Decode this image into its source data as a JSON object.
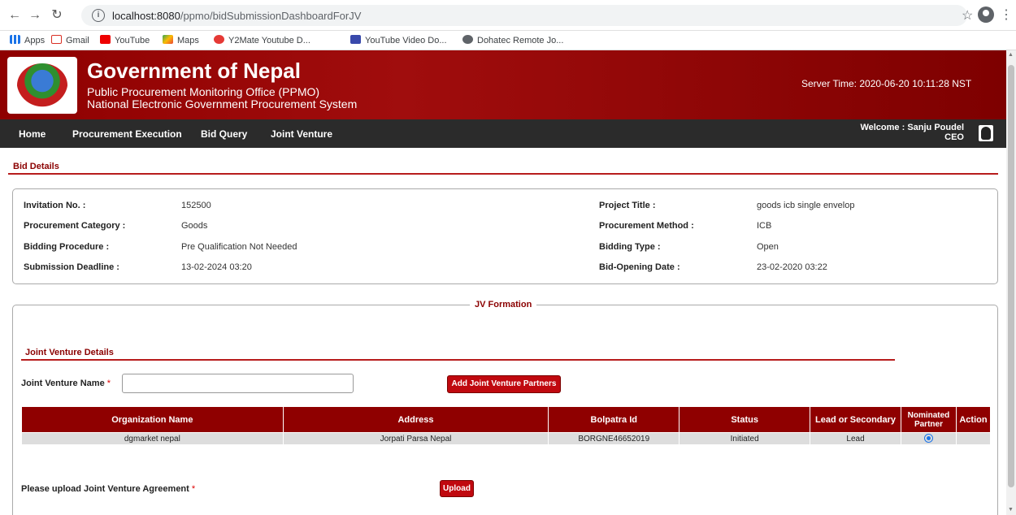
{
  "browser": {
    "url_host": "localhost:8080",
    "url_path": "/ppmo/bidSubmissionDashboardForJV",
    "bookmarks": [
      "Apps",
      "Gmail",
      "YouTube",
      "Maps",
      "Y2Mate Youtube D...",
      "YouTube Video Do...",
      "Dohatec Remote Jo..."
    ]
  },
  "header": {
    "title": "Government of Nepal",
    "subtitle1": "Public Procurement Monitoring Office (PPMO)",
    "subtitle2": "National Electronic Government Procurement System",
    "server_time": "Server Time: 2020-06-20 10:11:28 NST"
  },
  "nav": {
    "items": [
      "Home",
      "Procurement Execution",
      "Bid Query",
      "Joint Venture"
    ],
    "welcome": "Welcome : Sanju Poudel",
    "role": "CEO"
  },
  "bid_details": {
    "section_title": "Bid Details",
    "rows": [
      {
        "label": "Invitation No. :",
        "value": "152500",
        "label2": "Project Title :",
        "value2": "goods icb single envelop"
      },
      {
        "label": "Procurement Category :",
        "value": "Goods",
        "label2": "Procurement Method :",
        "value2": "ICB"
      },
      {
        "label": "Bidding Procedure :",
        "value": "Pre Qualification Not Needed",
        "label2": "Bidding Type :",
        "value2": "Open"
      },
      {
        "label": "Submission Deadline :",
        "value": "13-02-2024 03:20",
        "label2": "Bid-Opening Date :",
        "value2": "23-02-2020 03:22"
      }
    ]
  },
  "jv": {
    "legend": "JV Formation",
    "details_title": "Joint Venture Details",
    "name_label": "Joint Venture Name",
    "required_mark": "*",
    "name_value": "",
    "add_button": "Add Joint Venture Partners",
    "table": {
      "headers": [
        "Organization Name",
        "Address",
        "Bolpatra Id",
        "Status",
        "Lead or Secondary",
        "Nominated Partner",
        "Action"
      ],
      "rows": [
        {
          "org": "dgmarket nepal",
          "address": "Jorpati Parsa Nepal",
          "bolpatra": "BORGNE46652019",
          "status": "Initiated",
          "lead": "Lead",
          "nominated": true,
          "action": ""
        }
      ]
    },
    "upload_label": "Please upload Joint Venture Agreement",
    "upload_button": "Upload"
  },
  "colors": {
    "brand_red": "#8f0000",
    "button_red": "#c0090f",
    "nav_dark": "#2b2b2b"
  }
}
